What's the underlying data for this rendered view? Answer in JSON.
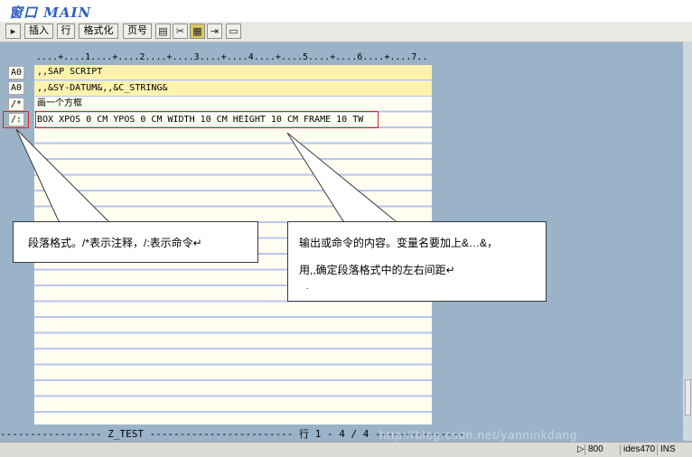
{
  "window": {
    "title": "窗口 MAIN"
  },
  "toolbar": {
    "buttons": [
      {
        "label": "插入"
      },
      {
        "label": "行"
      },
      {
        "label": "格式化"
      },
      {
        "label": "页号"
      }
    ]
  },
  "ruler": "....+....1....+....2....+....3....+....4....+....5....+....6....+....7..",
  "editor": {
    "rows": [
      {
        "format": "A0",
        "text": ",,SAP SCRIPT"
      },
      {
        "format": "A0",
        "text": ",,&SY-DATUM&,,&C_STRING&"
      },
      {
        "format": "/*",
        "text": "画一个方框"
      },
      {
        "format": "/:",
        "text": "BOX XPOS 0 CM YPOS 0 CM WIDTH 10 CM HEIGHT 10 CM FRAME 10 TW"
      }
    ]
  },
  "callouts": {
    "left": {
      "text": "段落格式。/*表示注释，/:表示命令↵"
    },
    "right": {
      "line1": "输出或命令的内容。变量名要加上&…&，",
      "line2": "用,,确定段落格式中的左右间距↵",
      "line3": "."
    }
  },
  "status": {
    "line": "----------------- Z_TEST ------------------------ 行 1 - 4 / 4 ---------------",
    "bar": {
      "client": "800",
      "system": "ides470",
      "mode": "INS"
    }
  },
  "watermark": "http://blog.csdn.net/yanninkdang"
}
